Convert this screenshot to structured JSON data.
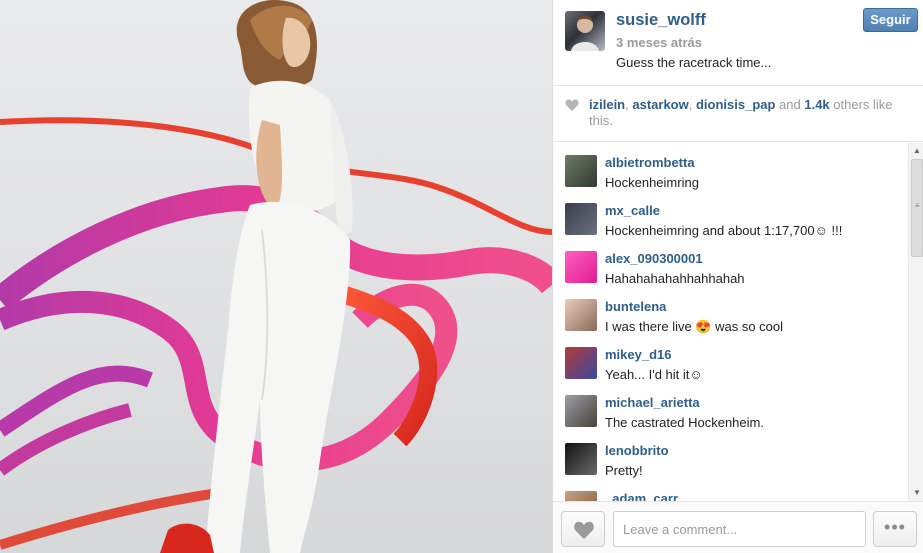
{
  "post": {
    "username": "susie_wolff",
    "time_ago": "3 meses atrás",
    "caption": "Guess the racetrack time...",
    "follow_label": "Seguir"
  },
  "likes": {
    "users": [
      "izilein",
      "astarkow",
      "dionisis_pap"
    ],
    "sep1": ", ",
    "sep2": ", ",
    "and_text": " and ",
    "count": "1.4k",
    "suffix": " others like this."
  },
  "comments": [
    {
      "user": "albietrombetta",
      "text": "Hockenheimring"
    },
    {
      "user": "mx_calle",
      "text": "Hockenheimring and about 1:17,700☺ !!!"
    },
    {
      "user": "alex_090300001",
      "text": "Hahahahahahhahhahah"
    },
    {
      "user": "buntelena",
      "text": "I was there live 😍 was so cool"
    },
    {
      "user": "mikey_d16",
      "text": "Yeah... I'd hit it☺"
    },
    {
      "user": "michael_arietta",
      "text": "The castrated Hockenheim."
    },
    {
      "user": "lenobbrito",
      "text": "Pretty!"
    },
    {
      "user": "_adam_carr",
      "text": ""
    }
  ],
  "footer": {
    "comment_placeholder": "Leave a comment...",
    "more_label": "•••"
  },
  "icons": {
    "like": "heart-icon",
    "more": "ellipsis-icon"
  },
  "colors": {
    "username": "#2f5e89",
    "follow_button": "#5a8bbb",
    "ribbon_pink": "#e0368f",
    "ribbon_red": "#e8402e"
  }
}
